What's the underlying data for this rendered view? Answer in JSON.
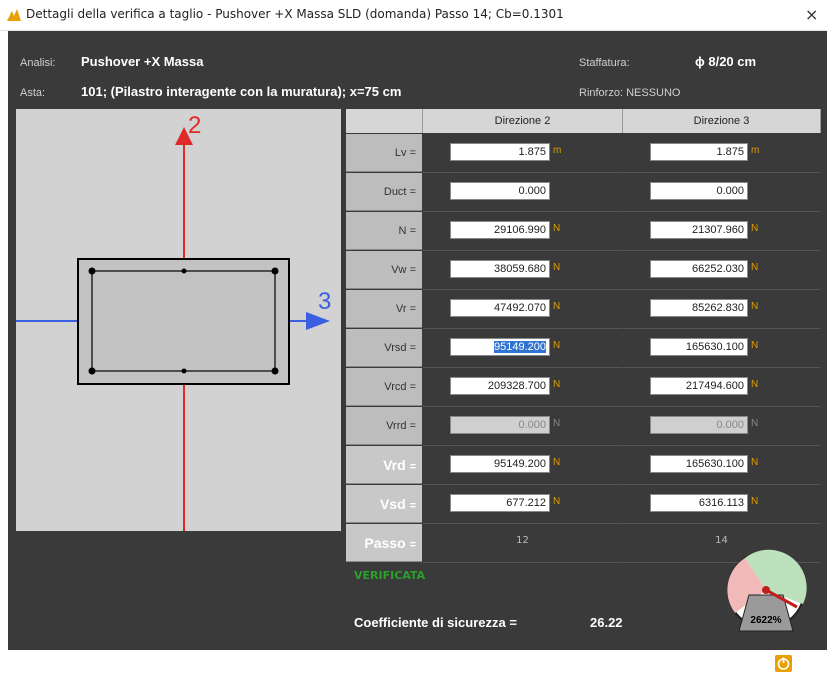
{
  "window": {
    "title": "Dettagli della verifica a taglio - Pushover +X Massa SLD (domanda) Passo 14; Cb=0.1301",
    "close_glyph": "×"
  },
  "header": {
    "analisi_label": "Analisi:",
    "analisi_value": "Pushover +X Massa",
    "asta_label": "Asta:",
    "asta_value": "101; (Pilastro interagente con la muratura); x=75 cm",
    "staffatura_label": "Staffatura:",
    "staffatura_value": "ϕ 8/20 cm",
    "rinforzo_label": "Rinforzo: NESSUNO"
  },
  "section": {
    "axis_2_label": "2",
    "axis_3_label": "3",
    "colors": {
      "axis2": "#e02a2a",
      "axis3": "#3a5fe0"
    }
  },
  "table": {
    "columns": [
      "Direzione 2",
      "Direzione 3"
    ],
    "rows": [
      {
        "label": "Lv",
        "eq": "=",
        "d2": "1.875",
        "d3": "1.875",
        "unit": "m"
      },
      {
        "label": "Duct",
        "eq": "=",
        "d2": "0.000",
        "d3": "0.000",
        "unit": ""
      },
      {
        "label": "N",
        "eq": "=",
        "d2": "29106.990",
        "d3": "21307.960",
        "unit": "N"
      },
      {
        "label": "Vw",
        "eq": "=",
        "d2": "38059.680",
        "d3": "66252.030",
        "unit": "N"
      },
      {
        "label": "Vr",
        "eq": "=",
        "d2": "47492.070",
        "d3": "85262.830",
        "unit": "N"
      },
      {
        "label": "Vrsd",
        "eq": "=",
        "d2_plain": "",
        "d2_hl": "95149.200",
        "d3": "165630.100",
        "unit": "N"
      },
      {
        "label": "Vrcd",
        "eq": "=",
        "d2": "209328.700",
        "d3": "217494.600",
        "unit": "N"
      },
      {
        "label": "Vrrd",
        "eq": "=",
        "d2": "0.000",
        "d3": "0.000",
        "unit": "N"
      },
      {
        "label": "Vrd",
        "eq": "=",
        "d2": "95149.200",
        "d3": "165630.100",
        "unit": "N"
      },
      {
        "label": "Vsd",
        "eq": "=",
        "d2": "677.212",
        "d3": "6316.113",
        "unit": "N"
      },
      {
        "label": "Passo",
        "eq": "=",
        "d2": "12",
        "d3": "14",
        "unit": ""
      }
    ]
  },
  "status_text": "VERIFICATA",
  "coefficient": {
    "label": "Coefficiente di sicurezza =",
    "value": "26.22"
  },
  "gauge": {
    "percent_label": "2622%"
  },
  "close_button": {
    "label": "Chiudi"
  }
}
